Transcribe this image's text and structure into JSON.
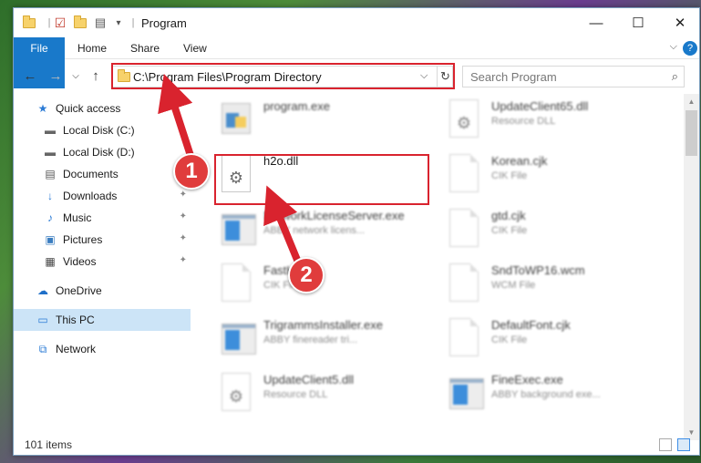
{
  "window": {
    "title": "Program",
    "controls": {
      "minimize": "—",
      "maximize": "☐",
      "close": "✕"
    }
  },
  "ribbon": {
    "tabs": [
      "File",
      "Home",
      "Share",
      "View"
    ],
    "expand_icon": "⌵",
    "help": "?"
  },
  "address": {
    "path": "C:\\Program Files\\Program Directory",
    "dropdown": "⌵",
    "refresh": "↻"
  },
  "search": {
    "placeholder": "Search Program",
    "icon": "⌕"
  },
  "nav": {
    "back": "←",
    "forward": "→",
    "recent": "⌵",
    "up": "↑"
  },
  "sidebar": {
    "items": [
      {
        "label": "Quick access",
        "icon": "★"
      },
      {
        "label": "Local Disk (C:)",
        "icon": "▬"
      },
      {
        "label": "Local Disk (D:)",
        "icon": "▬"
      },
      {
        "label": "Documents",
        "icon": "▤"
      },
      {
        "label": "Downloads",
        "icon": "↓"
      },
      {
        "label": "Music",
        "icon": "♪"
      },
      {
        "label": "Pictures",
        "icon": "▣"
      },
      {
        "label": "Videos",
        "icon": "▦"
      },
      {
        "label": "OneDrive",
        "icon": "☁"
      },
      {
        "label": "This PC",
        "icon": "▭"
      },
      {
        "label": "Network",
        "icon": "⧉"
      }
    ],
    "pin_icon": "📌"
  },
  "files": {
    "left": [
      {
        "name": "program.exe",
        "desc": ""
      },
      {
        "name": "h2o.dll",
        "desc": ""
      },
      {
        "name": "NetworkLicenseServer.exe",
        "desc": "ABBY network licens..."
      },
      {
        "name": "FastH...",
        "desc": "CIK File"
      },
      {
        "name": "TrigrammsInstaller.exe",
        "desc": "ABBY finereader tri..."
      },
      {
        "name": "UpdateClient5.dll",
        "desc": "Resource DLL"
      }
    ],
    "right": [
      {
        "name": "UpdateClient65.dll",
        "desc": "Resource DLL"
      },
      {
        "name": "Korean.cjk",
        "desc": "CIK File"
      },
      {
        "name": "gtd.cjk",
        "desc": "CIK File"
      },
      {
        "name": "SndToWP16.wcm",
        "desc": "WCM File"
      },
      {
        "name": "DefaultFont.cjk",
        "desc": "CIK File"
      },
      {
        "name": "FineExec.exe",
        "desc": "ABBY background exe..."
      }
    ]
  },
  "status": {
    "count": "101 items"
  },
  "annotations": {
    "step1": "1",
    "step2": "2",
    "color": "#d9232e"
  }
}
